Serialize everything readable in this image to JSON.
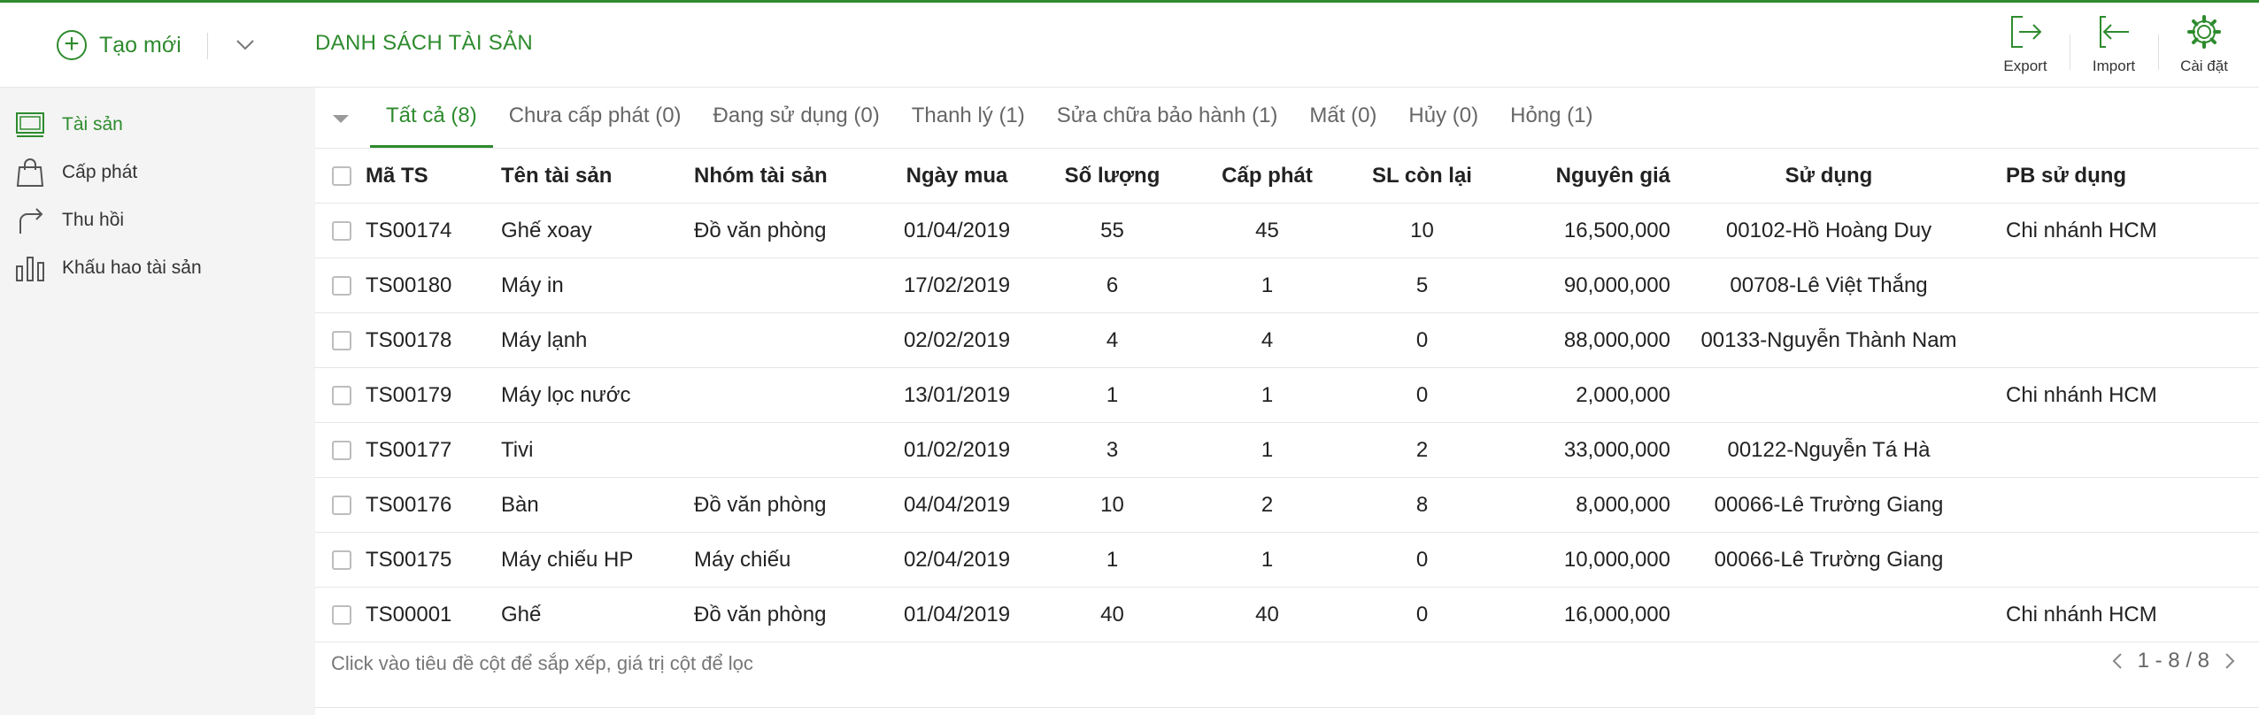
{
  "header": {
    "create_label": "Tạo mới",
    "page_title": "DANH SÁCH TÀI SẢN",
    "actions": {
      "export": "Export",
      "import": "Import",
      "settings": "Cài đặt"
    }
  },
  "sidebar": {
    "items": [
      {
        "label": "Tài sản",
        "icon": "monitor-icon",
        "active": true
      },
      {
        "label": "Cấp phát",
        "icon": "bag-icon",
        "active": false
      },
      {
        "label": "Thu hồi",
        "icon": "share-arrow-icon",
        "active": false
      },
      {
        "label": "Khấu hao tài sản",
        "icon": "bar-chart-icon",
        "active": false
      }
    ]
  },
  "tabs": [
    {
      "label": "Tất cả (8)",
      "active": true
    },
    {
      "label": "Chưa cấp phát (0)"
    },
    {
      "label": "Đang sử dụng (0)"
    },
    {
      "label": "Thanh lý (1)"
    },
    {
      "label": "Sửa chữa bảo hành (1)"
    },
    {
      "label": "Mất (0)"
    },
    {
      "label": "Hủy (0)"
    },
    {
      "label": "Hỏng (1)"
    }
  ],
  "table": {
    "columns": [
      "Mã TS",
      "Tên tài sản",
      "Nhóm tài sản",
      "Ngày mua",
      "Số lượng",
      "Cấp phát",
      "SL còn lại",
      "Nguyên giá",
      "Sử dụng",
      "PB sử dụng"
    ],
    "rows": [
      [
        "TS00174",
        "Ghế xoay",
        "Đồ văn phòng",
        "01/04/2019",
        "55",
        "45",
        "10",
        "16,500,000",
        "00102-Hồ Hoàng Duy",
        "Chi nhánh HCM"
      ],
      [
        "TS00180",
        "Máy in",
        "",
        "17/02/2019",
        "6",
        "1",
        "5",
        "90,000,000",
        "00708-Lê Việt Thắng",
        ""
      ],
      [
        "TS00178",
        "Máy lạnh",
        "",
        "02/02/2019",
        "4",
        "4",
        "0",
        "88,000,000",
        "00133-Nguyễn Thành Nam",
        ""
      ],
      [
        "TS00179",
        "Máy lọc nước",
        "",
        "13/01/2019",
        "1",
        "1",
        "0",
        "2,000,000",
        "",
        "Chi nhánh HCM"
      ],
      [
        "TS00177",
        "Tivi",
        "",
        "01/02/2019",
        "3",
        "1",
        "2",
        "33,000,000",
        "00122-Nguyễn Tá Hà",
        ""
      ],
      [
        "TS00176",
        "Bàn",
        "Đồ văn phòng",
        "04/04/2019",
        "10",
        "2",
        "8",
        "8,000,000",
        "00066-Lê Trường Giang",
        ""
      ],
      [
        "TS00175",
        "Máy chiếu HP",
        "Máy chiếu",
        "02/04/2019",
        "1",
        "1",
        "0",
        "10,000,000",
        "00066-Lê Trường Giang",
        ""
      ],
      [
        "TS00001",
        "Ghế",
        "Đồ văn phòng",
        "01/04/2019",
        "40",
        "40",
        "0",
        "16,000,000",
        "",
        "Chi nhánh HCM"
      ]
    ]
  },
  "footer": {
    "hint": "Click vào tiêu đề cột để sắp xếp, giá trị cột để lọc",
    "pagination": "1 - 8 / 8"
  },
  "colors": {
    "accent": "#2e8b2e",
    "sidebar_bg": "#f4f4f4",
    "border": "#e6e6e6"
  }
}
